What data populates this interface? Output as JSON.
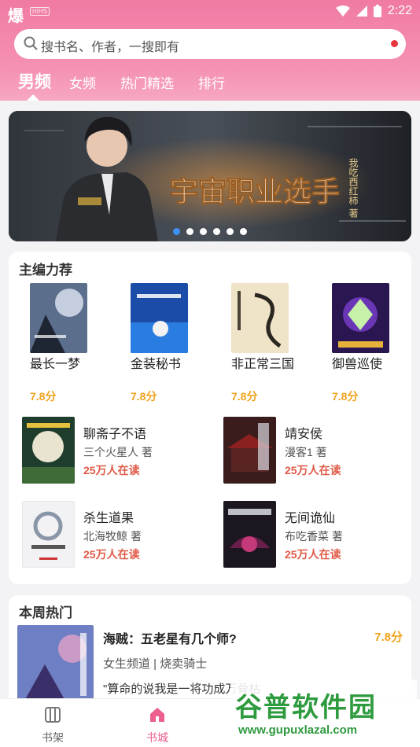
{
  "status": {
    "left_glyph": "爆",
    "left_badge": "HIHS",
    "time": "2:22"
  },
  "search": {
    "placeholder": "搜书名、作者，一搜即有"
  },
  "tabs": [
    {
      "label": "男频",
      "active": true
    },
    {
      "label": "女频",
      "active": false
    },
    {
      "label": "热门精选",
      "active": false
    },
    {
      "label": "排行",
      "active": false
    }
  ],
  "banner": {
    "title_text": "宇宙职业选手",
    "author_text": "我吃西红柿 著",
    "slides": 6,
    "active_slide": 0
  },
  "editor_picks": {
    "title": "主编力荐",
    "grid": [
      {
        "title": "最长一梦",
        "score": "7.8分"
      },
      {
        "title": "金装秘书",
        "score": "7.8分"
      },
      {
        "title": "非正常三国",
        "score": "7.8分"
      },
      {
        "title": "御兽巡使",
        "score": "7.8分"
      }
    ],
    "list": [
      {
        "title": "聊斋子不语",
        "author": "三个火星人 著",
        "readers": "25万人在读"
      },
      {
        "title": "靖安侯",
        "author": "漫客1 著",
        "readers": "25万人在读"
      },
      {
        "title": "杀生道果",
        "author": "北海牧鲸 著",
        "readers": "25万人在读"
      },
      {
        "title": "无间诡仙",
        "author": "布吃香菜 著",
        "readers": "25万人在读"
      }
    ]
  },
  "weekly": {
    "title": "本周热门",
    "item": {
      "title": "海贼：五老星有几个师?",
      "score": "7.8分",
      "meta": "女生频道 | 烧卖骑士",
      "desc": "\"算命的说我是一将功成万骨枯"
    }
  },
  "bottom_nav": [
    {
      "label": "书架",
      "active": false
    },
    {
      "label": "书城",
      "active": true
    }
  ],
  "watermark": {
    "text": "谷普软件园",
    "url": "www.gupuxlazal.com"
  },
  "colors": {
    "accent": "#ec5f8e",
    "header": "#f07aa3",
    "score": "#f0a31c",
    "readers": "#e05a47"
  }
}
